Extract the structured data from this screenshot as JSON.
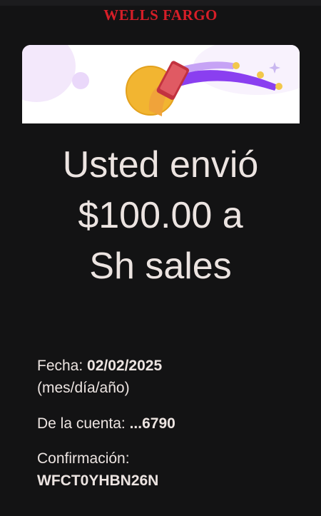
{
  "header": {
    "logo_text": "WELLS FARGO",
    "logo_color": "#d71e28"
  },
  "banner": {
    "illustration": "phone-send-money-illustration",
    "colors": {
      "coin": "#f2b531",
      "trail": "#8a3ff0",
      "background_accent": "#efe3fa"
    }
  },
  "headline": {
    "line1": "Usted envió",
    "line2": "$100.00 a",
    "line3": "Sh sales"
  },
  "details": {
    "date_label": "Fecha:",
    "date_value": "02/02/2025",
    "date_format": "(mes/día/año)",
    "account_label": "De la cuenta:",
    "account_value": "...6790",
    "confirmation_label": "Confirmación:",
    "confirmation_value": "WFCT0YHBN26N"
  },
  "theme": {
    "background": "#131314",
    "text": "#ece4e1"
  }
}
